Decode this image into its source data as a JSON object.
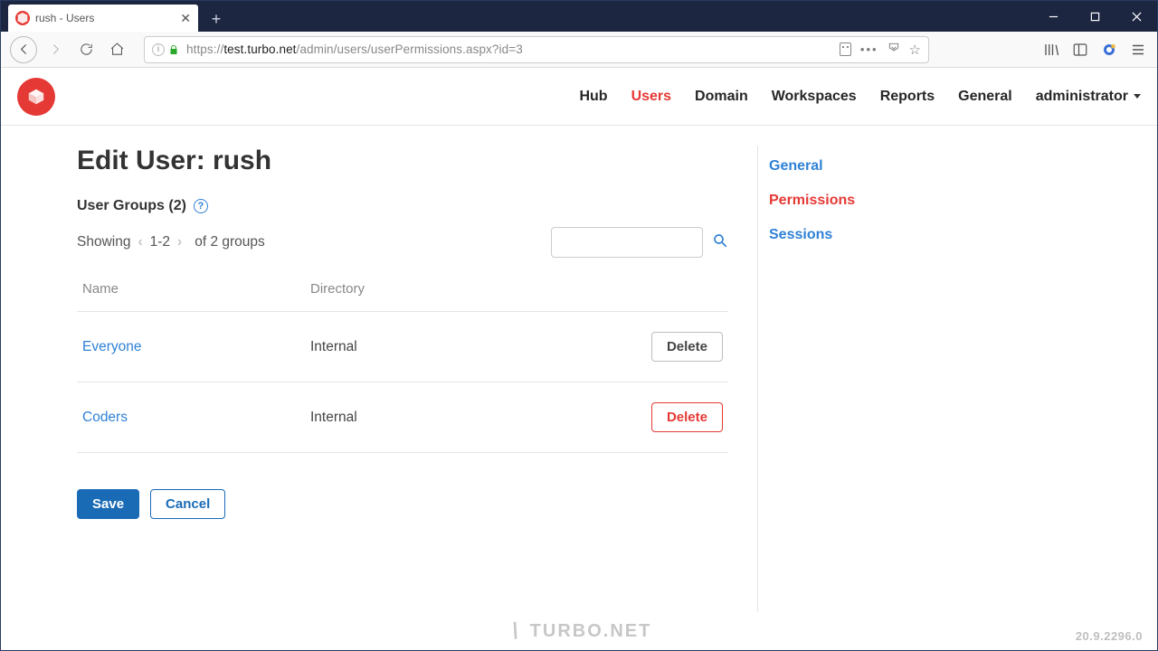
{
  "browser": {
    "tab_title": "rush - Users",
    "url_proto": "https://",
    "url_host": "test.turbo.net",
    "url_path": "/admin/users/userPermissions.aspx?id=3"
  },
  "nav": {
    "items": [
      "Hub",
      "Users",
      "Domain",
      "Workspaces",
      "Reports",
      "General"
    ],
    "active_index": 1,
    "account_label": "administrator"
  },
  "page": {
    "title": "Edit User: rush",
    "groups_label": "User Groups (2)",
    "pager": {
      "showing_label": "Showing",
      "range": "1-2",
      "suffix": "of 2 groups"
    },
    "table": {
      "headers": [
        "Name",
        "Directory",
        ""
      ],
      "rows": [
        {
          "name": "Everyone",
          "directory": "Internal",
          "delete_label": "Delete",
          "delete_style": "grey"
        },
        {
          "name": "Coders",
          "directory": "Internal",
          "delete_label": "Delete",
          "delete_style": "red"
        }
      ]
    },
    "save_label": "Save",
    "cancel_label": "Cancel"
  },
  "sidenav": {
    "items": [
      "General",
      "Permissions",
      "Sessions"
    ],
    "active_index": 1
  },
  "footer": {
    "brand": "TURBO.NET",
    "version": "20.9.2296.0"
  }
}
